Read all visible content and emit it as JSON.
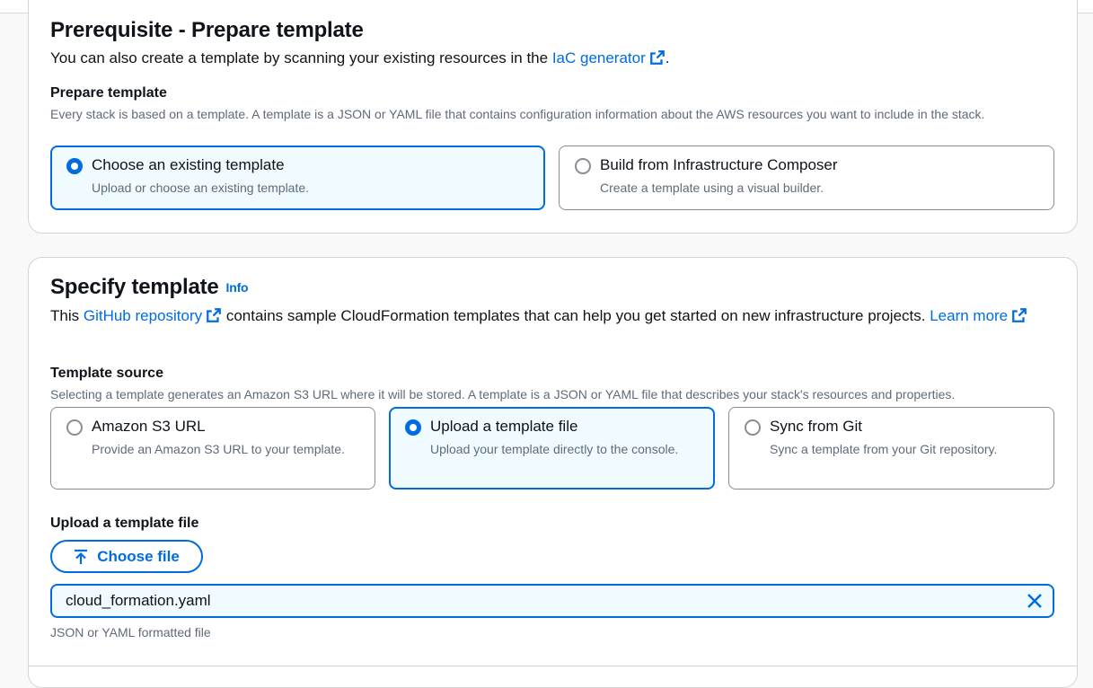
{
  "prerequisite": {
    "title": "Prerequisite - Prepare template",
    "description_before": "You can also create a template by scanning your existing resources in the ",
    "iac_link": "IaC generator",
    "description_after": ".",
    "prepare_label": "Prepare template",
    "prepare_hint": "Every stack is based on a template. A template is a JSON or YAML file that contains configuration information about the AWS resources you want to include in the stack.",
    "options": [
      {
        "title": "Choose an existing template",
        "desc": "Upload or choose an existing template.",
        "selected": true
      },
      {
        "title": "Build from Infrastructure Composer",
        "desc": "Create a template using a visual builder.",
        "selected": false
      }
    ]
  },
  "specify": {
    "title": "Specify template",
    "info": "Info",
    "desc_this": "This ",
    "github_link": "GitHub repository",
    "desc_middle": " contains sample CloudFormation templates that can help you get started on new infrastructure projects. ",
    "learn_more": "Learn more",
    "source_label": "Template source",
    "source_hint": "Selecting a template generates an Amazon S3 URL where it will be stored. A template is a JSON or YAML file that describes your stack's resources and properties.",
    "sources": [
      {
        "title": "Amazon S3 URL",
        "desc": "Provide an Amazon S3 URL to your template.",
        "selected": false
      },
      {
        "title": "Upload a template file",
        "desc": "Upload your template directly to the console.",
        "selected": true
      },
      {
        "title": "Sync from Git",
        "desc": "Sync a template from your Git repository.",
        "selected": false
      }
    ],
    "upload_label": "Upload a template file",
    "choose_file": "Choose file",
    "file_name": "cloud_formation.yaml",
    "file_hint": "JSON or YAML formatted file"
  },
  "colors": {
    "accent": "#006ce0",
    "selected_bg": "#f0fbff",
    "muted": "#5f6b7a"
  },
  "icons": [
    "external-link-icon",
    "upload-arrow-icon",
    "close-icon",
    "radio-icon"
  ]
}
